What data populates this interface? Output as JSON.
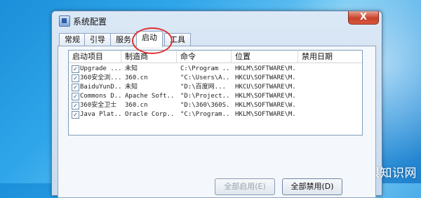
{
  "window": {
    "title": "系统配置",
    "close_label": "X"
  },
  "tabs": [
    {
      "label": "常规"
    },
    {
      "label": "引导"
    },
    {
      "label": "服务"
    },
    {
      "label": "启动",
      "active": true
    },
    {
      "label": "工具"
    }
  ],
  "table": {
    "columns": [
      "启动项目",
      "制造商",
      "命令",
      "位置",
      "禁用日期"
    ],
    "rows": [
      {
        "checked": true,
        "item": "Upgrade ...",
        "maker": "未知",
        "command": "C:\\Program ...",
        "location": "HKLM\\SOFTWARE\\M...",
        "date": ""
      },
      {
        "checked": true,
        "item": "360安全浏...",
        "maker": "360.cn",
        "command": "\"C:\\Users\\A...",
        "location": "HKCU\\SOFTWARE\\M...",
        "date": ""
      },
      {
        "checked": true,
        "item": "BaiduYunD...",
        "maker": "未知",
        "command": "\"D:\\百度网...",
        "location": "HKCU\\SOFTWARE\\M...",
        "date": ""
      },
      {
        "checked": true,
        "item": "Commons D...",
        "maker": "Apache Soft...",
        "command": "\"D:\\Project...",
        "location": "HKLM\\SOFTWARE\\M...",
        "date": ""
      },
      {
        "checked": true,
        "item": "360安全卫士",
        "maker": "360.cn",
        "command": "\"D:\\360\\360S...",
        "location": "HKLM\\SOFTWARE\\W...",
        "date": ""
      },
      {
        "checked": true,
        "item": "Java Plat...",
        "maker": "Oracle Corp...",
        "command": "\"C:\\Program...",
        "location": "HKLM\\SOFTWARE\\M...",
        "date": ""
      }
    ]
  },
  "buttons": {
    "enable_all": "全部启用(E)",
    "disable_all": "全部禁用(D)"
  },
  "watermark": "爱创根知识网",
  "colors": {
    "highlight_ring": "#e0302f",
    "desktop": "#2fa6ea"
  }
}
